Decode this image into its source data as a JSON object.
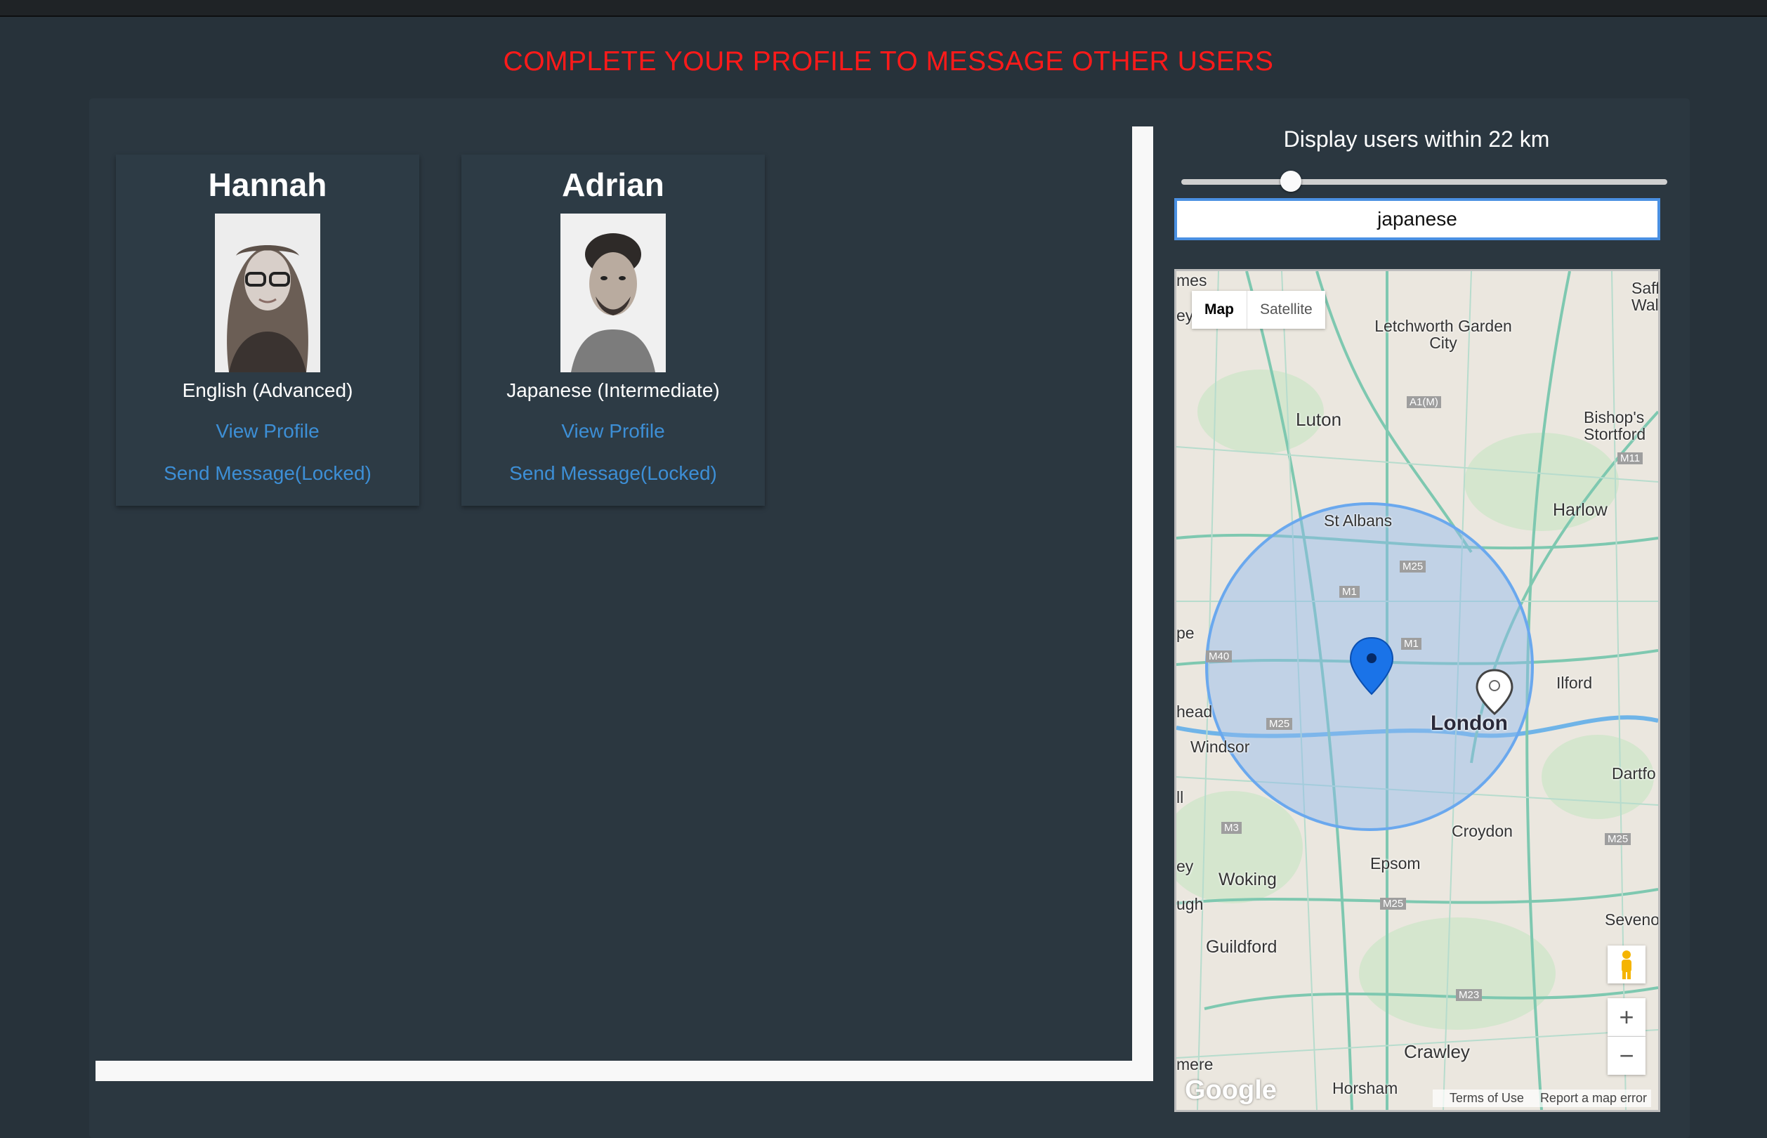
{
  "banner": "COMPLETE YOUR PROFILE TO MESSAGE OTHER USERS",
  "users": [
    {
      "name": "Hannah",
      "language": "English (Advanced)",
      "view_profile": "View Profile",
      "send_message": "Send Message(Locked)"
    },
    {
      "name": "Adrian",
      "language": "Japanese (Intermediate)",
      "view_profile": "View Profile",
      "send_message": "Send Message(Locked)"
    }
  ],
  "filter": {
    "radius_label": "Display users within 22 km",
    "radius_km": 22,
    "search_value": "japanese"
  },
  "map": {
    "type_buttons": {
      "map": "Map",
      "satellite": "Satellite"
    },
    "zoom_in": "+",
    "zoom_out": "−",
    "footer": {
      "brand": "Google",
      "terms": "Terms of Use",
      "report": "Report a map error"
    },
    "labels": {
      "letchworth": "Letchworth Garden City",
      "luton": "Luton",
      "bishops": "Bishop's Stortford",
      "harlow": "Harlow",
      "st_albans": "St Albans",
      "london": "London",
      "ilford": "Ilford",
      "windsor": "Windsor",
      "dartford": "Dartfo",
      "croydon": "Croydon",
      "epsom": "Epsom",
      "woking": "Woking",
      "guildford": "Guildford",
      "sevenoaks": "Sevenoa",
      "crawley": "Crawley",
      "horsham": "Horsham",
      "saffron": "Saff Wal",
      "ley": "ey",
      "pe": "pe",
      "head": "head",
      "ll": "ll",
      "ey2": "ey",
      "ugh": "ugh",
      "mere": "mere",
      "mes": "mes",
      "a1m": "A1(M)",
      "m11": "M11",
      "m25a": "M25",
      "m25b": "M25",
      "m25c": "M25",
      "m25d": "M25",
      "m1a": "M1",
      "m1b": "M1",
      "m40": "M40",
      "m3": "M3",
      "m23": "M23"
    }
  },
  "colors": {
    "banner": "#ff1a1a",
    "link": "#3d8fd6",
    "radius_fill": "#8fb8f0",
    "pin_user": "#1a73e8"
  }
}
